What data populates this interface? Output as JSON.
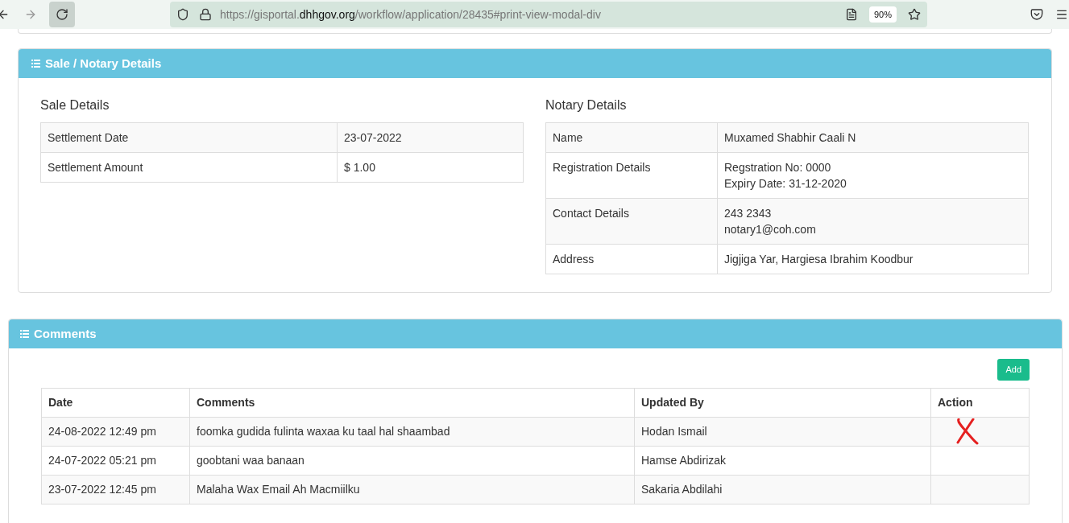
{
  "browser": {
    "url_prefix": "https://gisportal.",
    "url_domain": "dhhgov.org",
    "url_path": "/workflow/application/28435#print-view-modal-div",
    "zoom": "90%"
  },
  "sale_panel": {
    "title": "Sale / Notary Details",
    "sale": {
      "heading": "Sale Details",
      "rows": [
        {
          "label": "Settlement Date",
          "value": [
            "23-07-2022"
          ]
        },
        {
          "label": "Settlement Amount",
          "value": [
            "$ 1.00"
          ]
        }
      ]
    },
    "notary": {
      "heading": "Notary Details",
      "rows": [
        {
          "label": "Name",
          "value": [
            "Muxamed Shabhir Caali N"
          ]
        },
        {
          "label": "Registration Details",
          "value": [
            "Regstration No: 0000",
            "Expiry Date: 31-12-2020"
          ]
        },
        {
          "label": "Contact Details",
          "value": [
            "243 2343",
            "notary1@coh.com"
          ]
        },
        {
          "label": "Address",
          "value": [
            "Jigjiga Yar, Hargiesa Ibrahim Koodbur"
          ]
        }
      ]
    }
  },
  "comments_panel": {
    "title": "Comments",
    "add_button": "Add",
    "columns": [
      "Date",
      "Comments",
      "Updated By",
      "Action"
    ],
    "rows": [
      {
        "date": "24-08-2022 12:49 pm",
        "comment": "foomka gudida fulinta waxaa ku taal hal shaambad",
        "updated_by": "Hodan Ismail",
        "marked": true
      },
      {
        "date": "24-07-2022 05:21 pm",
        "comment": "goobtani waa banaan",
        "updated_by": "Hamse Abdirizak",
        "marked": false
      },
      {
        "date": "23-07-2022 12:45 pm",
        "comment": "Malaha Wax Email Ah Macmiilku",
        "updated_by": "Sakaria Abdilahi",
        "marked": false
      }
    ]
  }
}
